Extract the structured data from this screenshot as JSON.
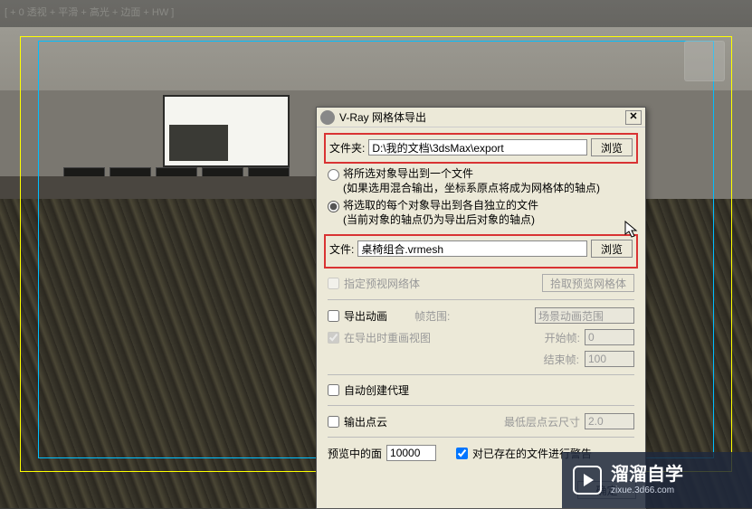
{
  "viewport": {
    "label": "[ + 0 透视 + 平滑 + 高光 + 边面 + HW ]"
  },
  "dialog": {
    "title": "V-Ray 网格体导出",
    "folder_label": "文件夹:",
    "folder_value": "D:\\我的文档\\3dsMax\\export",
    "browse_btn": "浏览",
    "radio1_line1": "将所选对象导出到一个文件",
    "radio1_line2": "(如果选用混合输出，坐标系原点将成为网格体的轴点)",
    "radio2_line1": "将选取的每个对象导出到各自独立的文件",
    "radio2_line2": "(当前对象的轴点仍为导出后对象的轴点)",
    "file_label": "文件:",
    "file_value": "桌椅组合.vrmesh",
    "browse2_btn": "浏览",
    "preview_net": "指定预视网络体",
    "preview_net_btn": "拾取预览网格体",
    "export_anim": "导出动画",
    "frame_range_label": "帧范围:",
    "frame_range_value": "场景动画范围",
    "redraw_viewport": "在导出时重画视图",
    "start_frame_label": "开始帧:",
    "start_frame_value": "0",
    "end_frame_label": "结束帧:",
    "end_frame_value": "100",
    "auto_proxy": "自动创建代理",
    "output_pointcloud": "输出点云",
    "min_point_label": "最低层点云尺寸",
    "min_point_value": "2.0",
    "preview_faces_label": "预览中的面",
    "preview_faces_value": "10000",
    "warn_existing": "对已存在的文件进行警告",
    "ok_btn": "确定"
  },
  "watermark": {
    "text": "溜溜自学",
    "url": "zixue.3d66.com"
  }
}
